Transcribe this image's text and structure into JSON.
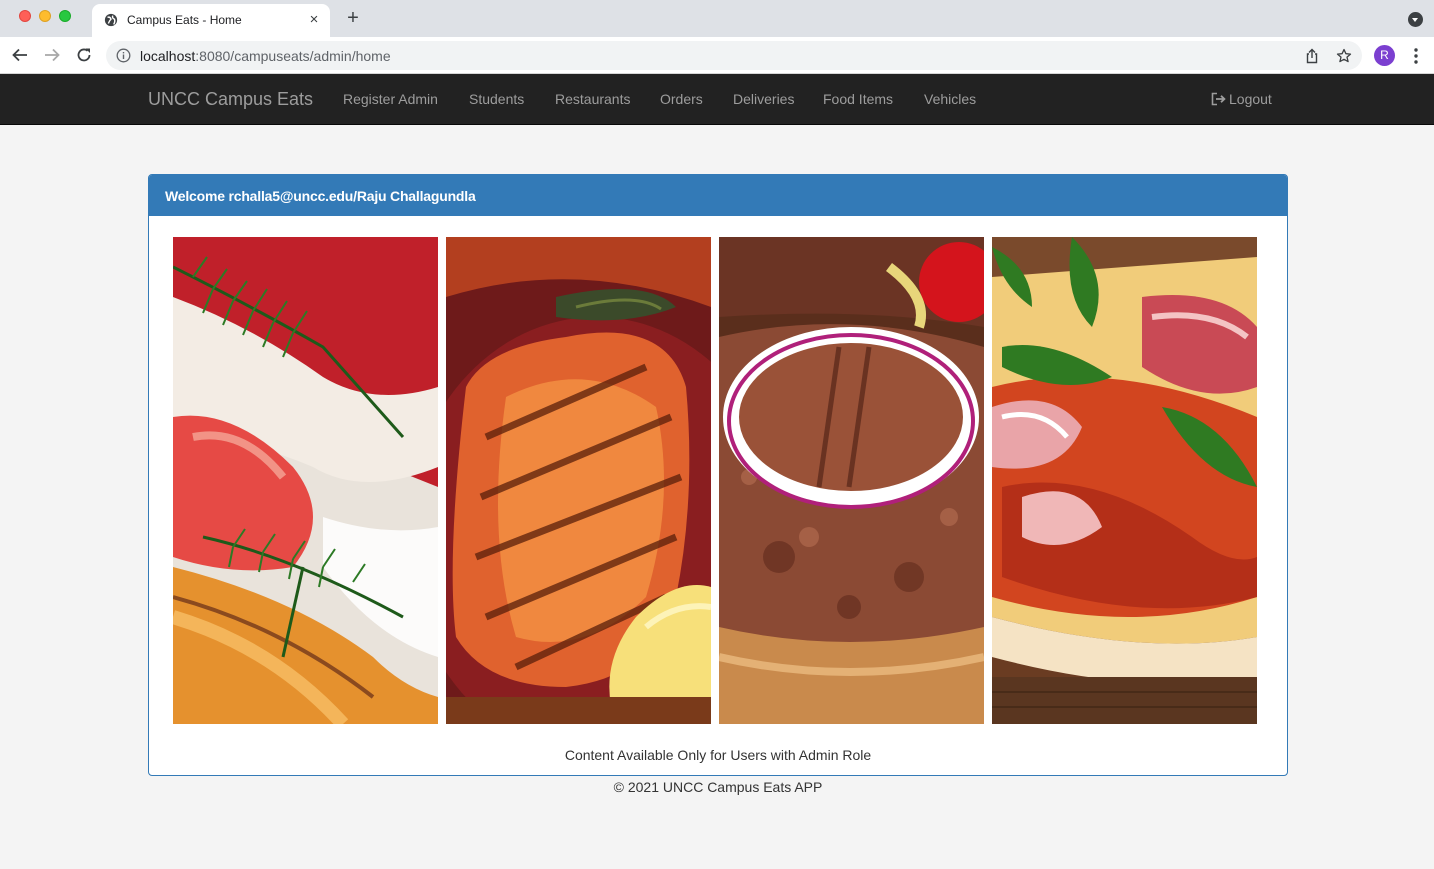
{
  "browser": {
    "tab_title": "Campus Eats - Home",
    "tab_close": "×",
    "new_tab": "+",
    "url_host": "localhost",
    "url_path": ":8080/campuseats/admin/home",
    "profile_initial": "R"
  },
  "navbar": {
    "brand": "UNCC Campus Eats",
    "links": [
      "Register Admin",
      "Students",
      "Restaurants",
      "Orders",
      "Deliveries",
      "Food Items",
      "Vehicles"
    ],
    "logout": "Logout"
  },
  "panel": {
    "heading": "Welcome rchalla5@uncc.edu/Raju Challagundla",
    "images": [
      "prosciutto-with-rosemary",
      "grilled-chicken-breast",
      "grilled-burger-patty-with-onion",
      "pizza-with-prosciutto-and-arugula"
    ],
    "caption": "Content Available Only for Users with Admin Role"
  },
  "footer": {
    "text": "© 2021 UNCC Campus Eats APP"
  },
  "colors": {
    "navbar_bg": "#222222",
    "navbar_text": "#9d9d9d",
    "panel_primary": "#337ab7",
    "page_bg": "#f4f4f4"
  }
}
